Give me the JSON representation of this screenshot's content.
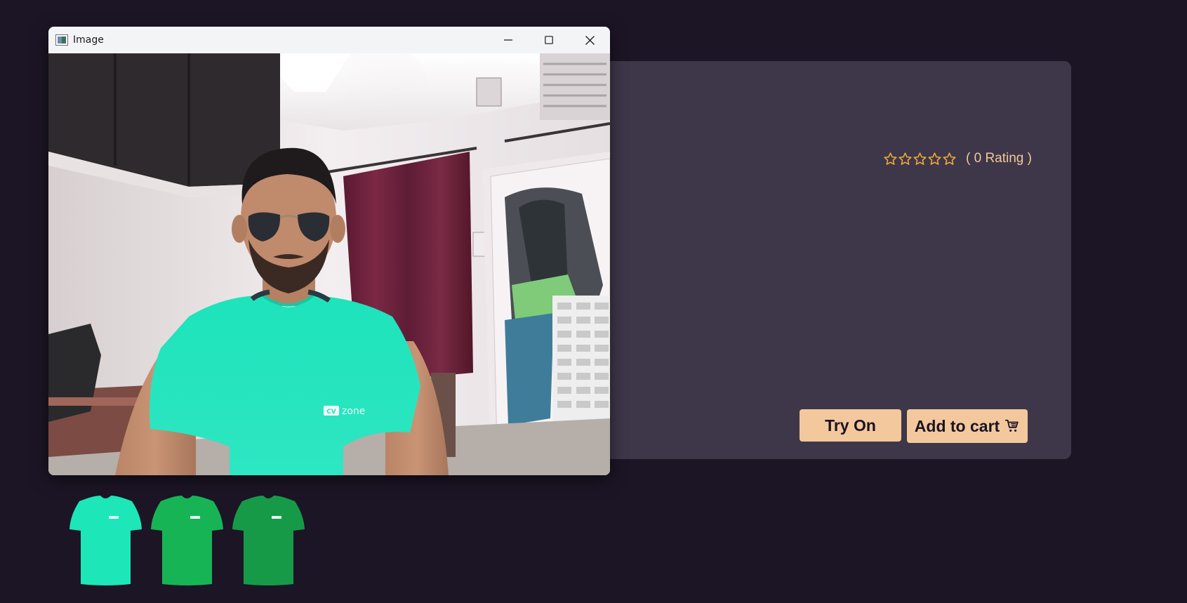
{
  "window": {
    "title": "Image",
    "icon": "image-app-icon",
    "controls": [
      "minimize-icon",
      "maximize-icon",
      "close-icon"
    ]
  },
  "camera": {
    "overlay_logo": "CV zone"
  },
  "product": {
    "rating": {
      "stars_filled": 0,
      "stars_total": 5,
      "text": "( 0 Rating )",
      "star_color": "#f2a93b"
    },
    "buttons": {
      "try_on": "Try On",
      "add_to_cart": "Add to cart",
      "cart_icon": "cart-icon"
    },
    "button_color": "#f3c89d"
  },
  "thumbnails": [
    {
      "name": "tshirt-turquoise",
      "color": "#1de6b8"
    },
    {
      "name": "tshirt-green",
      "color": "#17b455"
    },
    {
      "name": "tshirt-dark-green",
      "color": "#169a48"
    }
  ],
  "colors": {
    "page_bg": "#1c1526",
    "card_bg": "#3e3749",
    "rating_text": "#f2c89a"
  }
}
